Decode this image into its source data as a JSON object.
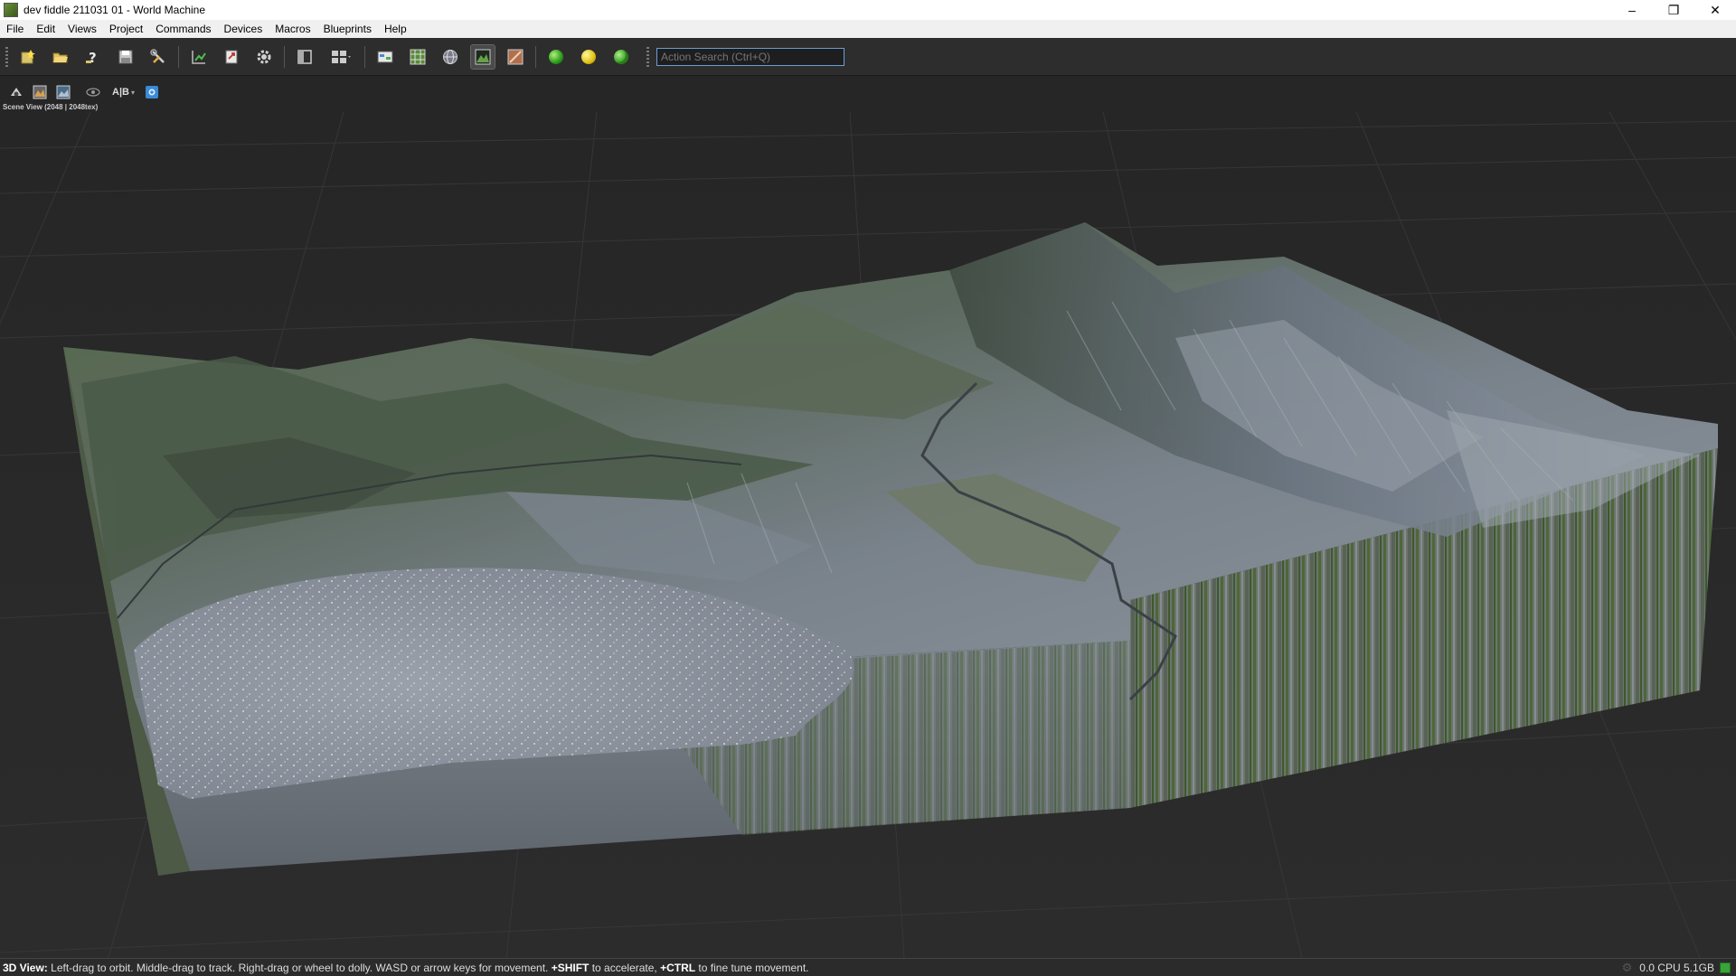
{
  "window": {
    "title": "dev fiddle 211031 01 - World Machine",
    "controls": {
      "minimize": "–",
      "restore": "❐",
      "close": "✕"
    }
  },
  "menu": [
    "File",
    "Edit",
    "Views",
    "Project",
    "Commands",
    "Devices",
    "Macros",
    "Blueprints",
    "Help"
  ],
  "toolbar": {
    "icons": [
      "new-project-icon",
      "open-project-icon",
      "help-icon",
      "save-icon",
      "tools-icon",
      "build-icon",
      "export-icon",
      "settings-gear-icon",
      "panel-toggle-icon",
      "layout-grid-icon",
      "device-view-icon",
      "tiled-view-icon",
      "globe-view-icon",
      "terrain-view-icon",
      "texture-view-icon",
      "build-status-green-icon",
      "build-status-yellow-icon",
      "build-status-world-icon"
    ],
    "search_placeholder": "Action Search (Ctrl+Q)"
  },
  "viewbar": {
    "ab_label": "A|B",
    "caret": "▾"
  },
  "scene_info": "Scene View (2048 | 2048tex)",
  "status": {
    "prefix": "3D View:",
    "part1": " Left-drag to orbit. Middle-drag to track. Right-drag or wheel to dolly. WASD or arrow keys for movement. ",
    "shift": "+SHIFT",
    "part2": " to accelerate, ",
    "ctrl": "+CTRL",
    "part3": " to fine tune movement.",
    "stats": "0.0 CPU 5.1GB"
  },
  "colors": {
    "accent": "#6a9ed6",
    "terrain_grass": "#4f6a3a",
    "terrain_rock": "#6a7280",
    "water": "#8a929e"
  }
}
